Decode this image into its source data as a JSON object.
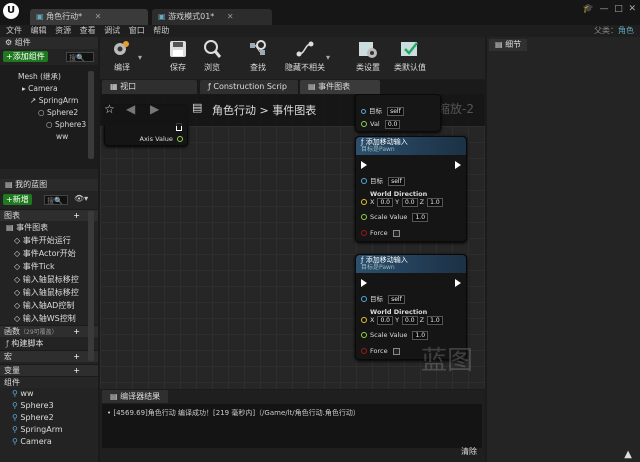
{
  "window": {
    "tabs": [
      {
        "label": "角色行动*"
      },
      {
        "label": "游戏模式01*"
      }
    ],
    "parent_label": "父类：",
    "parent_value": "角色"
  },
  "menu": [
    "文件",
    "编辑",
    "资源",
    "查看",
    "调试",
    "窗口",
    "帮助"
  ],
  "components": {
    "title": "组件",
    "add_button": "+添加组件",
    "search_placeholder": "搜",
    "tree": [
      "Mesh (继承)",
      "Camera",
      "SpringArm",
      "Sphere2",
      "Sphere3",
      "ww"
    ]
  },
  "my_blueprint": {
    "title": "我的蓝图",
    "new_button": "+新增",
    "search_placeholder": "搜",
    "graphs_cat": "图表",
    "event_graph": "事件图表",
    "events": [
      "事件开始运行",
      "事件Actor开始",
      "事件Tick",
      "输入轴鼠标移控",
      "输入轴鼠标移控",
      "输入轴AD控制",
      "输入轴WS控制"
    ],
    "functions_cat": "函数",
    "functions_count": "（29可覆盖）",
    "construction_script": "构建脚本",
    "macros_cat": "宏",
    "variables_cat": "变量",
    "components_cat": "组件",
    "variables": [
      "ww",
      "Sphere3",
      "Sphere2",
      "SpringArm",
      "Camera"
    ]
  },
  "toolbar": [
    {
      "label": "编译",
      "icon": "compile-icon"
    },
    {
      "label": "保存",
      "icon": "save-icon"
    },
    {
      "label": "浏览",
      "icon": "browse-icon"
    },
    {
      "label": "查找",
      "icon": "find-icon"
    },
    {
      "label": "隐藏不相关",
      "icon": "hide-unrelated-icon"
    },
    {
      "label": "类设置",
      "icon": "class-settings-icon"
    },
    {
      "label": "类默认值",
      "icon": "class-defaults-icon"
    }
  ],
  "graph_tabs": [
    "视口",
    "Construction Scrip",
    "事件图表"
  ],
  "breadcrumb": {
    "root": "角色行动",
    "separator": ">",
    "current": "事件图表",
    "zoom": "缩放-2"
  },
  "nodes": {
    "axis_value": "Axis Value",
    "partial_target": "目标",
    "partial_self": "self",
    "partial_val": "Val",
    "partial_val_value": "0.0",
    "node1": {
      "title": "添加移动输入",
      "subtitle": "目标是Pawn",
      "target_label": "目标",
      "target_value": "self",
      "dir_label": "World Direction",
      "x": "0.0",
      "y": "0.0",
      "z": "1.0",
      "scale_label": "Scale Value",
      "scale_value": "1.0",
      "force_label": "Force"
    },
    "node2": {
      "title": "添加移动输入",
      "subtitle": "目标是Pawn",
      "target_label": "目标",
      "target_value": "self",
      "dir_label": "World Direction",
      "x": "0.0",
      "y": "0.0",
      "z": "1.0",
      "scale_label": "Scale Value",
      "scale_value": "1.0",
      "force_label": "Force"
    }
  },
  "watermark": "蓝图",
  "compiler": {
    "tab": "编译器结果",
    "message": "[4569.69]角色行动 编译成功！[219 毫秒内]（/Game/lt/角色行动.角色行动）",
    "clear_button": "清除"
  },
  "details": {
    "tab": "细节"
  }
}
